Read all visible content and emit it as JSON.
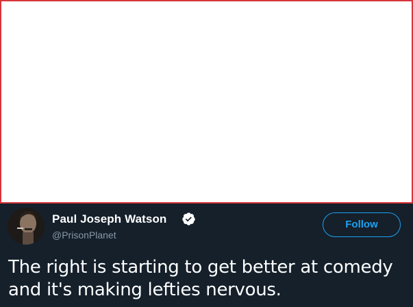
{
  "tweet": {
    "author_name": "Paul Joseph Watson",
    "author_handle": "@PrisonPlanet",
    "verified": true,
    "follow_label": "Follow",
    "text": "The right is starting to get better at comedy and it's making lefties nervous."
  },
  "colors": {
    "background": "#15202b",
    "media_border": "#d6343b",
    "accent": "#1da1f2",
    "handle": "#8899a6",
    "text": "#ffffff"
  },
  "icons": {
    "verified": "verified-badge-icon",
    "avatar": "profile-photo"
  }
}
